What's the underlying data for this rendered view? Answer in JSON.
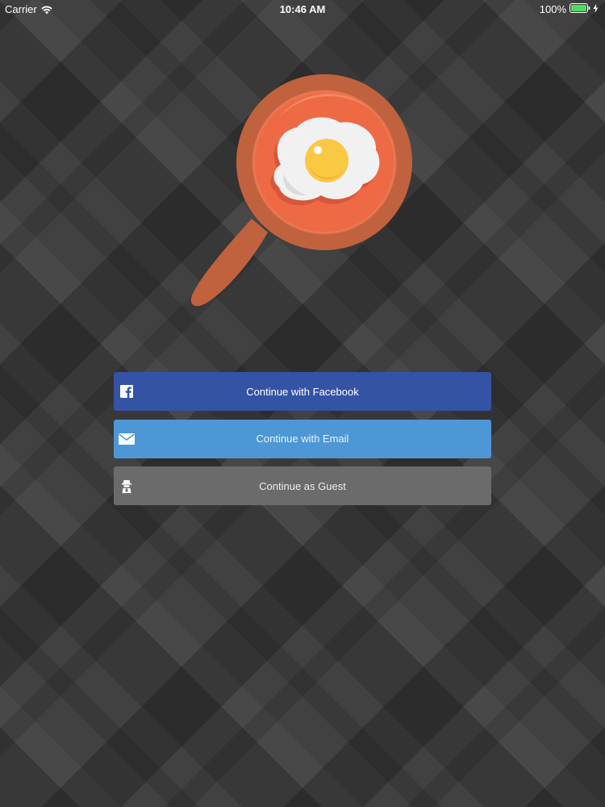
{
  "status_bar": {
    "carrier": "Carrier",
    "time": "10:46 AM",
    "battery": "100%"
  },
  "logo": {
    "icon": "frying-pan-egg-icon"
  },
  "buttons": {
    "facebook": {
      "label": "Continue with Facebook",
      "icon": "facebook-icon",
      "color": "#3453a4"
    },
    "email": {
      "label": "Continue with Email",
      "icon": "envelope-icon",
      "color": "#4e97d7"
    },
    "guest": {
      "label": "Continue as Guest",
      "icon": "guest-icon",
      "color": "#6b6b6b"
    }
  },
  "colors": {
    "pan_rim": "#c0623d",
    "pan_inner": "#ee6a45",
    "egg_white": "#f1f1f1",
    "yolk": "#fbc843"
  }
}
